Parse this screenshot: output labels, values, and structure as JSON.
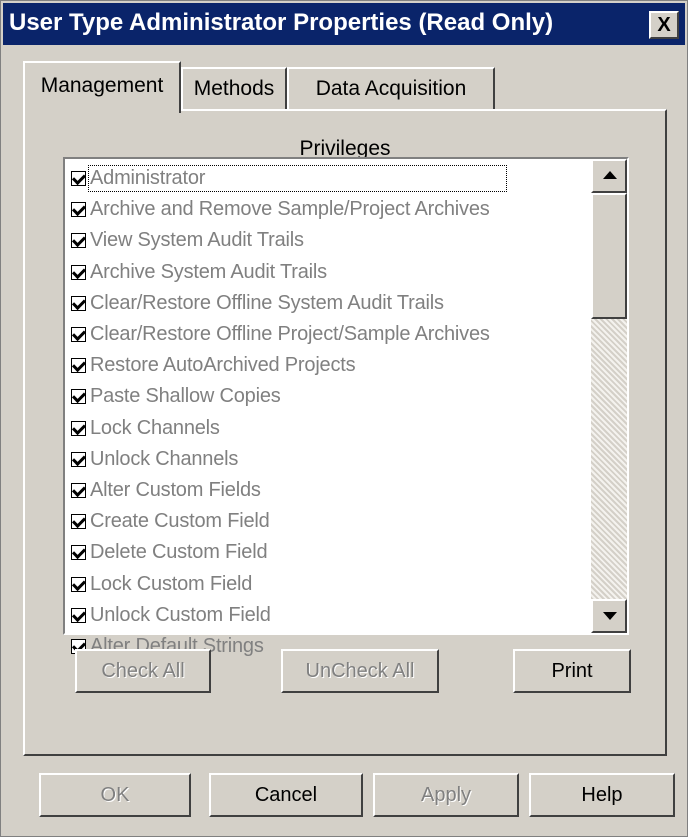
{
  "dialog": {
    "title": "User Type Administrator Properties (Read Only)",
    "close_label": "X"
  },
  "tabs": [
    {
      "label": "Management",
      "selected": true
    },
    {
      "label": "Methods",
      "selected": false
    },
    {
      "label": "Data Acquisition",
      "selected": false
    }
  ],
  "privileges": {
    "label": "Privileges",
    "items": [
      {
        "label": "Administrator",
        "checked": true
      },
      {
        "label": "Archive and Remove Sample/Project Archives",
        "checked": true
      },
      {
        "label": "View System Audit Trails",
        "checked": true
      },
      {
        "label": "Archive System Audit Trails",
        "checked": true
      },
      {
        "label": "Clear/Restore Offline System Audit Trails",
        "checked": true
      },
      {
        "label": "Clear/Restore Offline Project/Sample Archives",
        "checked": true
      },
      {
        "label": "Restore AutoArchived Projects",
        "checked": true
      },
      {
        "label": "Paste Shallow Copies",
        "checked": true
      },
      {
        "label": "Lock Channels",
        "checked": true
      },
      {
        "label": "Unlock Channels",
        "checked": true
      },
      {
        "label": "Alter Custom Fields",
        "checked": true
      },
      {
        "label": "Create Custom Field",
        "checked": true
      },
      {
        "label": "Delete Custom Field",
        "checked": true
      },
      {
        "label": "Lock Custom Field",
        "checked": true
      },
      {
        "label": "Unlock Custom Field",
        "checked": true
      },
      {
        "label": "Alter Default Strings",
        "checked": true
      }
    ]
  },
  "buttons": {
    "check_all": "Check All",
    "uncheck_all": "UnCheck All",
    "print": "Print",
    "ok": "OK",
    "cancel": "Cancel",
    "apply": "Apply",
    "help": "Help"
  },
  "colors": {
    "titlebar": "#0a246a",
    "face": "#d4d0c8",
    "disabled_text": "#808080"
  }
}
